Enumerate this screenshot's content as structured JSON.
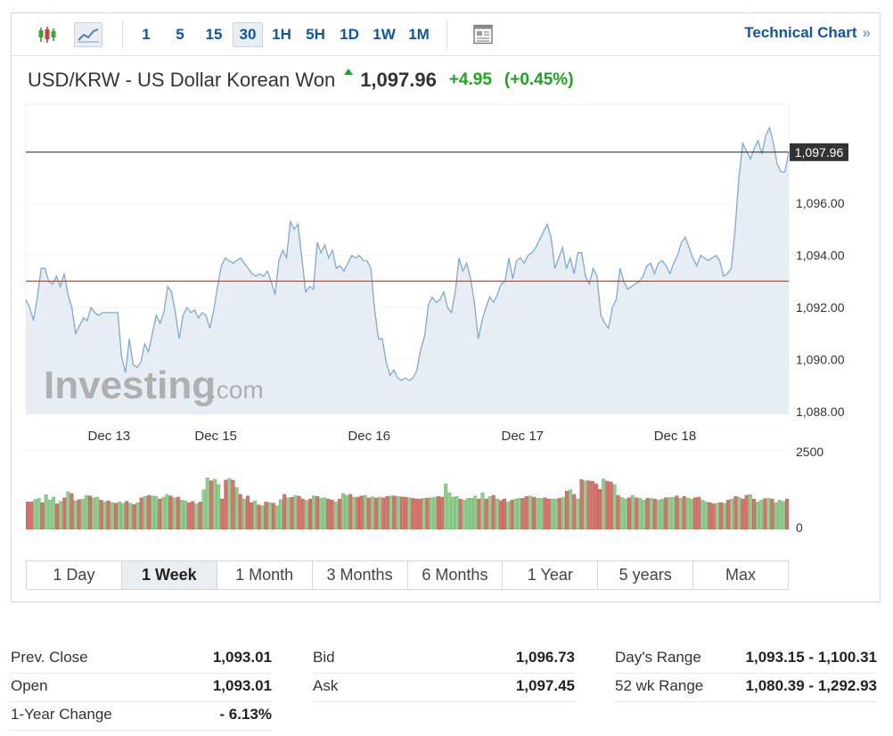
{
  "toolbar": {
    "intervals": [
      "1",
      "5",
      "15",
      "30",
      "1H",
      "5H",
      "1D",
      "1W",
      "1M"
    ],
    "active_interval": "30",
    "technical_chart_label": "Technical Chart",
    "technical_chart_chevron": "»",
    "icons": [
      "candlestick-icon",
      "line-chart-icon",
      "news-icon"
    ]
  },
  "quote": {
    "pair_name": "USD/KRW - US Dollar Korean Won",
    "last_price": "1,097.96",
    "change": "+4.95",
    "change_pct": "(+0.45%)",
    "direction": "up"
  },
  "colors": {
    "accent_blue": "#1256a0",
    "up_green": "#1ea51e",
    "line": "#7fa9d3",
    "area": "#e6edf3",
    "prev_close_line": "#c0392b",
    "volume_up": "#8fce8f",
    "volume_down": "#d9726d"
  },
  "chart_data": {
    "type": "area",
    "title": "USD/KRW - US Dollar Korean Won",
    "x_labels": [
      "Dec 13",
      "Dec 15",
      "Dec 16",
      "Dec 17",
      "Dec 18"
    ],
    "y_ticks": [
      "1,088.00",
      "1,090.00",
      "1,092.00",
      "1,094.00",
      "1,096.00"
    ],
    "ylim": [
      1087.9,
      1099.8
    ],
    "current_price_label": "1,097.96",
    "current_price": 1097.96,
    "prev_close": 1093.01,
    "price_series": [
      1092.3,
      1092.0,
      1091.5,
      1092.4,
      1093.5,
      1093.5,
      1093.0,
      1092.9,
      1093.2,
      1092.8,
      1093.3,
      1092.5,
      1092.0,
      1091.0,
      1091.3,
      1091.6,
      1091.5,
      1092.0,
      1091.8,
      1091.7,
      1091.8,
      1091.8,
      1091.8,
      1091.8,
      1091.8,
      1090.1,
      1089.5,
      1090.8,
      1089.8,
      1089.7,
      1089.9,
      1090.6,
      1090.3,
      1091.0,
      1091.7,
      1091.4,
      1091.8,
      1092.8,
      1092.6,
      1091.8,
      1090.8,
      1091.7,
      1092.0,
      1091.8,
      1091.9,
      1091.6,
      1091.8,
      1091.7,
      1091.2,
      1091.9,
      1092.8,
      1093.6,
      1093.9,
      1093.8,
      1093.7,
      1093.8,
      1093.9,
      1093.7,
      1093.5,
      1093.3,
      1093.2,
      1093.3,
      1093.2,
      1093.4,
      1093.0,
      1092.5,
      1093.8,
      1094.2,
      1093.9,
      1095.3,
      1095.0,
      1095.2,
      1093.9,
      1092.6,
      1092.8,
      1092.7,
      1094.5,
      1094.1,
      1094.4,
      1093.9,
      1094.2,
      1093.5,
      1093.6,
      1093.4,
      1093.7,
      1094.0,
      1093.9,
      1094.0,
      1093.8,
      1093.8,
      1093.5,
      1091.9,
      1090.8,
      1090.8,
      1089.9,
      1089.4,
      1089.6,
      1089.3,
      1089.2,
      1089.3,
      1089.2,
      1089.3,
      1089.6,
      1090.4,
      1090.9,
      1092.1,
      1092.4,
      1092.2,
      1092.3,
      1092.6,
      1092.0,
      1091.8,
      1092.6,
      1093.9,
      1093.4,
      1093.7,
      1093.1,
      1092.2,
      1090.8,
      1091.5,
      1092.0,
      1092.4,
      1092.2,
      1092.5,
      1092.9,
      1093.0,
      1093.9,
      1093.1,
      1093.8,
      1093.9,
      1093.7,
      1094.0,
      1094.1,
      1094.3,
      1094.6,
      1094.9,
      1095.2,
      1094.7,
      1093.5,
      1093.9,
      1094.3,
      1093.5,
      1093.9,
      1093.3,
      1094.1,
      1094.1,
      1093.2,
      1092.9,
      1093.5,
      1093.2,
      1091.7,
      1091.4,
      1091.2,
      1092.0,
      1092.3,
      1093.5,
      1093.0,
      1092.7,
      1092.8,
      1092.9,
      1093.0,
      1093.2,
      1093.6,
      1093.7,
      1093.3,
      1093.7,
      1093.8,
      1093.6,
      1093.3,
      1093.7,
      1094.0,
      1094.5,
      1094.7,
      1094.3,
      1093.9,
      1093.6,
      1094.0,
      1093.9,
      1093.8,
      1093.9,
      1094.0,
      1093.8,
      1093.2,
      1093.3,
      1093.5,
      1095.0,
      1097.0,
      1098.3,
      1098.0,
      1097.7,
      1098.1,
      1098.4,
      1097.9,
      1098.6,
      1098.9,
      1098.3,
      1097.5,
      1097.2,
      1097.2,
      1097.96
    ],
    "volume_ylabels": [
      "2500",
      "0"
    ],
    "volume_max": 2500,
    "volume_series": [
      900,
      900,
      980,
      1020,
      880,
      1140,
      960,
      1060,
      840,
      920,
      1040,
      1240,
      1180,
      940,
      980,
      1000,
      1120,
      1100,
      1040,
      1060,
      960,
      900,
      940,
      880,
      860,
      900,
      860,
      920,
      860,
      820,
      880,
      1040,
      1080,
      1120,
      1100,
      1080,
      1000,
      1060,
      1150,
      1100,
      1040,
      1060,
      960,
      940,
      880,
      920,
      840,
      900,
      1300,
      1700,
      1600,
      1650,
      1480,
      1000,
      1620,
      1680,
      1620,
      1380,
      1150,
      1000,
      1100,
      880,
      940,
      800,
      780,
      900,
      880,
      860,
      780,
      980,
      1150,
      1040,
      1050,
      1120,
      1090,
      1000,
      950,
      1000,
      1100,
      1080,
      1020,
      1040,
      1000,
      960,
      900,
      1000,
      1180,
      1120,
      1150,
      1060,
      1060,
      1100,
      1120,
      1040,
      1070,
      1030,
      1060,
      1040,
      1080,
      1100,
      1100,
      1080,
      1070,
      1060,
      1040,
      1020,
      1000,
      1000,
      1020,
      1030,
      1040,
      1060,
      1080,
      1060,
      1500,
      1200,
      1060,
      1080,
      1000,
      960,
      1020,
      1020,
      1100,
      1000,
      1200,
      1000,
      1080,
      1120,
      1000,
      950,
      1000,
      900,
      960,
      1000,
      1020,
      1020,
      1080,
      1100,
      1060,
      1020,
      1020,
      1040,
      1000,
      1000,
      1000,
      1020,
      1060,
      1260,
      1300,
      1150,
      1000,
      1640,
      1600,
      1600,
      1580,
      1500,
      1320,
      1660,
      1590,
      1560,
      1480,
      1120,
      1050,
      1000,
      1040,
      1120,
      1040,
      1020,
      960,
      1020,
      1020,
      1000,
      960,
      1000,
      1040,
      1050,
      1060,
      1100,
      1020,
      1080,
      1030,
      1000,
      1040,
      1060,
      960,
      900,
      880,
      840,
      860,
      880,
      860,
      960,
      1000,
      1080,
      1060,
      1000,
      1120,
      1140,
      1000,
      900,
      960,
      1010,
      1020,
      1000,
      880,
      960,
      920,
      1000
    ],
    "volume_up_flags": [
      0,
      0,
      1,
      1,
      0,
      1,
      1,
      1,
      0,
      1,
      0,
      1,
      0,
      1,
      0,
      1,
      1,
      0,
      1,
      1,
      0,
      1,
      0,
      1,
      0,
      1,
      1,
      0,
      1,
      0,
      1,
      0,
      1,
      0,
      1,
      1,
      0,
      1,
      1,
      0,
      1,
      0,
      1,
      1,
      0,
      0,
      1,
      0,
      1,
      1,
      0,
      1,
      1,
      0,
      0,
      1,
      0,
      1,
      0,
      1,
      0,
      0,
      1,
      0,
      1,
      0,
      1,
      0,
      1,
      1,
      0,
      1,
      0,
      1,
      0,
      0,
      1,
      0,
      1,
      0,
      1,
      1,
      0,
      0,
      1,
      0,
      1,
      1,
      0,
      1,
      0,
      0,
      1,
      0,
      1,
      0,
      1,
      0,
      0,
      1,
      0,
      1,
      0,
      0,
      1,
      0,
      0,
      0,
      1,
      0,
      1,
      1,
      0,
      0,
      1,
      1,
      1,
      1,
      0,
      1,
      1,
      1,
      1,
      0,
      1,
      0,
      1,
      0,
      1,
      0,
      0,
      1,
      0,
      1,
      1,
      0,
      0,
      1,
      0,
      1,
      1,
      0,
      0,
      1,
      1,
      0,
      1,
      0,
      1,
      0,
      1,
      0,
      1,
      0,
      0,
      0,
      0,
      1,
      0,
      0,
      1,
      0,
      1,
      1,
      0,
      1,
      0,
      1,
      1,
      0,
      1,
      0,
      1,
      1,
      0,
      1,
      1,
      0,
      1,
      0,
      1,
      1,
      0,
      0,
      1,
      1,
      0,
      0,
      1,
      0,
      1,
      0,
      1,
      0,
      1,
      0,
      0,
      1,
      0,
      1,
      1,
      0,
      1,
      0,
      1,
      1,
      1,
      0,
      0,
      1,
      1,
      1,
      0,
      1,
      0,
      0,
      0,
      1,
      0,
      1,
      1,
      1,
      0,
      0,
      0,
      1
    ]
  },
  "watermark": {
    "brand": "Investing",
    "suffix": ".com"
  },
  "range_tabs": {
    "items": [
      "1 Day",
      "1 Week",
      "1 Month",
      "3 Months",
      "6 Months",
      "1 Year",
      "5 years",
      "Max"
    ],
    "active": "1 Week"
  },
  "stats": {
    "col1": [
      {
        "label": "Prev. Close",
        "value": "1,093.01"
      },
      {
        "label": "Open",
        "value": "1,093.01"
      },
      {
        "label": "1-Year Change",
        "value": "- 6.13%"
      }
    ],
    "col2": [
      {
        "label": "Bid",
        "value": "1,096.73"
      },
      {
        "label": "Ask",
        "value": "1,097.45"
      }
    ],
    "col3": [
      {
        "label": "Day's Range",
        "value": "1,093.15 - 1,100.31"
      },
      {
        "label": "52 wk Range",
        "value": "1,080.39 - 1,292.93"
      }
    ]
  }
}
